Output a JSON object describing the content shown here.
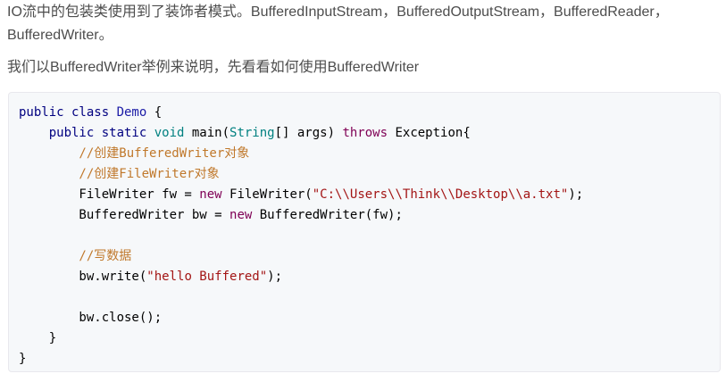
{
  "article": {
    "paragraph1": "IO流中的包装类使用到了装饰者模式。BufferedInputStream，BufferedOutputStream，BufferedReader，BufferedWriter。",
    "paragraph2": "我们以BufferedWriter举例来说明，先看看如何使用BufferedWriter"
  },
  "code": {
    "lines": [
      [
        {
          "t": "public class ",
          "c": "kw"
        },
        {
          "t": "Demo",
          "c": "cls"
        },
        {
          "t": " {",
          "c": "pl"
        }
      ],
      [
        {
          "t": "    public static ",
          "c": "kw"
        },
        {
          "t": "void",
          "c": "ty"
        },
        {
          "t": " main(",
          "c": "pl"
        },
        {
          "t": "String",
          "c": "ty"
        },
        {
          "t": "[] args) ",
          "c": "pl"
        },
        {
          "t": "throws",
          "c": "kw2"
        },
        {
          "t": " Exception{",
          "c": "pl"
        }
      ],
      [
        {
          "t": "        //创建BufferedWriter对象",
          "c": "cmt"
        }
      ],
      [
        {
          "t": "        //创建FileWriter对象",
          "c": "cmt"
        }
      ],
      [
        {
          "t": "        FileWriter fw = ",
          "c": "pl"
        },
        {
          "t": "new",
          "c": "kw2"
        },
        {
          "t": " FileWriter(",
          "c": "pl"
        },
        {
          "t": "\"C:\\\\Users\\\\Think\\\\Desktop\\\\a.txt\"",
          "c": "str"
        },
        {
          "t": ");",
          "c": "pl"
        }
      ],
      [
        {
          "t": "        BufferedWriter bw = ",
          "c": "pl"
        },
        {
          "t": "new",
          "c": "kw2"
        },
        {
          "t": " BufferedWriter(fw);",
          "c": "pl"
        }
      ],
      [
        {
          "t": "",
          "c": "pl"
        }
      ],
      [
        {
          "t": "        //写数据",
          "c": "cmt"
        }
      ],
      [
        {
          "t": "        bw.write(",
          "c": "pl"
        },
        {
          "t": "\"hello Buffered\"",
          "c": "str"
        },
        {
          "t": ");",
          "c": "pl"
        }
      ],
      [
        {
          "t": "",
          "c": "pl"
        }
      ],
      [
        {
          "t": "        bw.close();",
          "c": "pl"
        }
      ],
      [
        {
          "t": "    }",
          "c": "pl"
        }
      ],
      [
        {
          "t": "}",
          "c": "pl"
        }
      ]
    ]
  }
}
